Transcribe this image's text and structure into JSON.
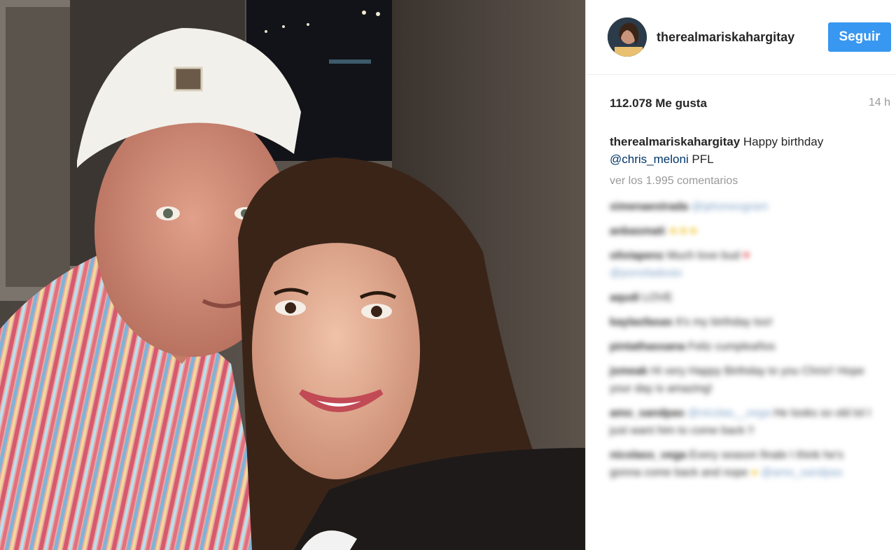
{
  "post": {
    "username": "therealmariskahargitay",
    "follow_label": "Seguir",
    "likes": "112.078 Me gusta",
    "time": "14 h",
    "caption_user": "therealmariskahargitay",
    "caption_text_1": "Happy birthday",
    "caption_mention": "@chris_meloni",
    "caption_text_2": "PFL",
    "view_comments": "ver los 1.995 comentarios"
  },
  "comments": [
    {
      "user": "ximenaestrada",
      "text": "",
      "mention": "@iphoneogram",
      "emoji": ""
    },
    {
      "user": "anbasmati",
      "text": "",
      "mention": "",
      "emoji": "★★★"
    },
    {
      "user": "oliviapenz",
      "text": "Much love bud",
      "mention": "@ponsfadesto",
      "emoji": "♥"
    },
    {
      "user": "aqudi",
      "text": "LOVE",
      "mention": "",
      "emoji": ""
    },
    {
      "user": "kaylasfasas",
      "text": "It's my birthday too!",
      "mention": "",
      "emoji": ""
    },
    {
      "user": "pintathassana",
      "text": "Feliz cumpleaños",
      "mention": "",
      "emoji": ""
    },
    {
      "user": "jsmeak",
      "text": "Hi very Happy Birthday to you Chris!! Hope your day is amazing!",
      "mention": "",
      "emoji": ""
    },
    {
      "user": "amo_sandpas",
      "text": "He looks so old lol I just want him to come back !!",
      "mention": "@nicolas__vega",
      "emoji": ""
    },
    {
      "user": "nicolass_vega",
      "text": "Every season finale I think he's gonna come back and nope",
      "mention": "@amo_sandpas",
      "emoji": "●"
    }
  ],
  "icons": {
    "avatar": "profile-avatar"
  },
  "colors": {
    "follow_button": "#3897f0",
    "mention": "#003569",
    "muted": "#999999"
  }
}
